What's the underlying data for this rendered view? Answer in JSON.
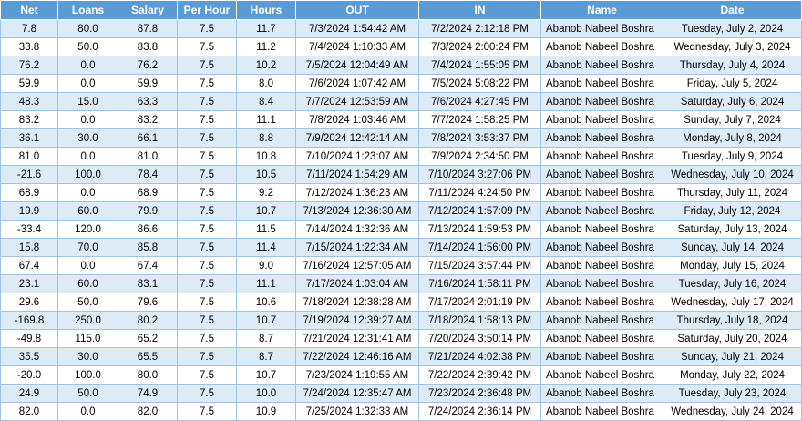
{
  "sheet": {
    "headers": [
      "Net",
      "Loans",
      "Salary",
      "Per Hour",
      "Hours",
      "OUT",
      "IN",
      "Name",
      "Date"
    ],
    "rows": [
      [
        "7.8",
        "80.0",
        "87.8",
        "7.5",
        "11.7",
        "7/3/2024 1:54:42 AM",
        "7/2/2024 2:12:18 PM",
        "Abanob Nabeel Boshra",
        "Tuesday, July 2, 2024"
      ],
      [
        "33.8",
        "50.0",
        "83.8",
        "7.5",
        "11.2",
        "7/4/2024 1:10:33 AM",
        "7/3/2024 2:00:24 PM",
        "Abanob Nabeel Boshra",
        "Wednesday, July 3, 2024"
      ],
      [
        "76.2",
        "0.0",
        "76.2",
        "7.5",
        "10.2",
        "7/5/2024 12:04:49 AM",
        "7/4/2024 1:55:05 PM",
        "Abanob Nabeel Boshra",
        "Thursday, July 4, 2024"
      ],
      [
        "59.9",
        "0.0",
        "59.9",
        "7.5",
        "8.0",
        "7/6/2024 1:07:42 AM",
        "7/5/2024 5:08:22 PM",
        "Abanob Nabeel Boshra",
        "Friday, July 5, 2024"
      ],
      [
        "48.3",
        "15.0",
        "63.3",
        "7.5",
        "8.4",
        "7/7/2024 12:53:59 AM",
        "7/6/2024 4:27:45 PM",
        "Abanob Nabeel Boshra",
        "Saturday, July 6, 2024"
      ],
      [
        "83.2",
        "0.0",
        "83.2",
        "7.5",
        "11.1",
        "7/8/2024 1:03:46 AM",
        "7/7/2024 1:58:25 PM",
        "Abanob Nabeel Boshra",
        "Sunday, July 7, 2024"
      ],
      [
        "36.1",
        "30.0",
        "66.1",
        "7.5",
        "8.8",
        "7/9/2024 12:42:14 AM",
        "7/8/2024 3:53:37 PM",
        "Abanob Nabeel Boshra",
        "Monday, July 8, 2024"
      ],
      [
        "81.0",
        "0.0",
        "81.0",
        "7.5",
        "10.8",
        "7/10/2024 1:23:07 AM",
        "7/9/2024 2:34:50 PM",
        "Abanob Nabeel Boshra",
        "Tuesday, July 9, 2024"
      ],
      [
        "-21.6",
        "100.0",
        "78.4",
        "7.5",
        "10.5",
        "7/11/2024 1:54:29 AM",
        "7/10/2024 3:27:06 PM",
        "Abanob Nabeel Boshra",
        "Wednesday, July 10, 2024"
      ],
      [
        "68.9",
        "0.0",
        "68.9",
        "7.5",
        "9.2",
        "7/12/2024 1:36:23 AM",
        "7/11/2024 4:24:50 PM",
        "Abanob Nabeel Boshra",
        "Thursday, July 11, 2024"
      ],
      [
        "19.9",
        "60.0",
        "79.9",
        "7.5",
        "10.7",
        "7/13/2024 12:36:30 AM",
        "7/12/2024 1:57:09 PM",
        "Abanob Nabeel Boshra",
        "Friday, July 12, 2024"
      ],
      [
        "-33.4",
        "120.0",
        "86.6",
        "7.5",
        "11.5",
        "7/14/2024 1:32:36 AM",
        "7/13/2024 1:59:53 PM",
        "Abanob Nabeel Boshra",
        "Saturday, July 13, 2024"
      ],
      [
        "15.8",
        "70.0",
        "85.8",
        "7.5",
        "11.4",
        "7/15/2024 1:22:34 AM",
        "7/14/2024 1:56:00 PM",
        "Abanob Nabeel Boshra",
        "Sunday, July 14, 2024"
      ],
      [
        "67.4",
        "0.0",
        "67.4",
        "7.5",
        "9.0",
        "7/16/2024 12:57:05 AM",
        "7/15/2024 3:57:44 PM",
        "Abanob Nabeel Boshra",
        "Monday, July 15, 2024"
      ],
      [
        "23.1",
        "60.0",
        "83.1",
        "7.5",
        "11.1",
        "7/17/2024 1:03:04 AM",
        "7/16/2024 1:58:11 PM",
        "Abanob Nabeel Boshra",
        "Tuesday, July 16, 2024"
      ],
      [
        "29.6",
        "50.0",
        "79.6",
        "7.5",
        "10.6",
        "7/18/2024 12:38:28 AM",
        "7/17/2024 2:01:19 PM",
        "Abanob Nabeel Boshra",
        "Wednesday, July 17, 2024"
      ],
      [
        "-169.8",
        "250.0",
        "80.2",
        "7.5",
        "10.7",
        "7/19/2024 12:39:27 AM",
        "7/18/2024 1:58:13 PM",
        "Abanob Nabeel Boshra",
        "Thursday, July 18, 2024"
      ],
      [
        "-49.8",
        "115.0",
        "65.2",
        "7.5",
        "8.7",
        "7/21/2024 12:31:41 AM",
        "7/20/2024 3:50:14 PM",
        "Abanob Nabeel Boshra",
        "Saturday, July 20, 2024"
      ],
      [
        "35.5",
        "30.0",
        "65.5",
        "7.5",
        "8.7",
        "7/22/2024 12:46:16 AM",
        "7/21/2024 4:02:38 PM",
        "Abanob Nabeel Boshra",
        "Sunday, July 21, 2024"
      ],
      [
        "-20.0",
        "100.0",
        "80.0",
        "7.5",
        "10.7",
        "7/23/2024 1:19:55 AM",
        "7/22/2024 2:39:42 PM",
        "Abanob Nabeel Boshra",
        "Monday, July 22, 2024"
      ],
      [
        "24.9",
        "50.0",
        "74.9",
        "7.5",
        "10.0",
        "7/24/2024 12:35:47 AM",
        "7/23/2024 2:36:48 PM",
        "Abanob Nabeel Boshra",
        "Tuesday, July 23, 2024"
      ],
      [
        "82.0",
        "0.0",
        "82.0",
        "7.5",
        "10.9",
        "7/25/2024 1:32:33 AM",
        "7/24/2024 2:36:14 PM",
        "Abanob Nabeel Boshra",
        "Wednesday, July 24, 2024"
      ]
    ]
  },
  "colors": {
    "header_bg": "#5b9bd5",
    "header_text": "#ffffff",
    "band_odd": "#ddebf7",
    "band_even": "#ffffff",
    "grid": "#9dc3e6"
  }
}
